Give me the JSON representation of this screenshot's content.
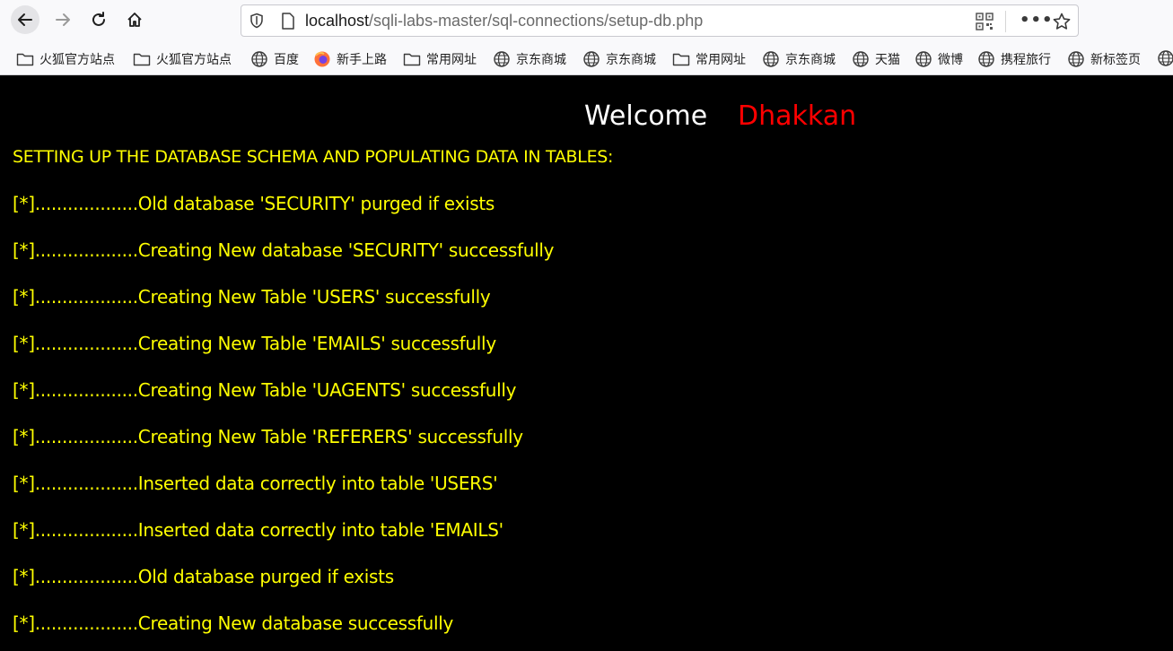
{
  "browser": {
    "url_host": "localhost",
    "url_path": "/sqli-labs-master/sql-connections/setup-db.php",
    "more_label": "•••",
    "bookmarks": [
      {
        "label": "火狐官方站点",
        "icon": "folder-icon"
      },
      {
        "label": "火狐官方站点",
        "icon": "folder-icon"
      },
      {
        "label": "百度",
        "icon": "globe-icon"
      },
      {
        "label": "新手上路",
        "icon": "firefox-icon"
      },
      {
        "label": "常用网址",
        "icon": "folder-icon"
      },
      {
        "label": "京东商城",
        "icon": "globe-icon"
      },
      {
        "label": "京东商城",
        "icon": "globe-icon"
      },
      {
        "label": "常用网址",
        "icon": "folder-icon"
      },
      {
        "label": "京东商城",
        "icon": "globe-icon"
      },
      {
        "label": "天猫",
        "icon": "globe-icon"
      },
      {
        "label": "微博",
        "icon": "globe-icon"
      },
      {
        "label": "携程旅行",
        "icon": "globe-icon"
      },
      {
        "label": "新标签页",
        "icon": "globe-icon"
      }
    ]
  },
  "page": {
    "welcome": "Welcome",
    "name": "Dhakkan",
    "heading": "SETTING UP THE DATABASE SCHEMA AND POPULATING DATA IN TABLES:",
    "lines": [
      "[*]...................Old database 'SECURITY' purged if exists",
      "[*]...................Creating New database 'SECURITY' successfully",
      "[*]...................Creating New Table 'USERS' successfully",
      "[*]...................Creating New Table 'EMAILS' successfully",
      "[*]...................Creating New Table 'UAGENTS' successfully",
      "[*]...................Creating New Table 'REFERERS' successfully",
      "[*]...................Inserted data correctly into table 'USERS'",
      "[*]...................Inserted data correctly into table 'EMAILS'",
      "[*]...................Old database purged if exists",
      "[*]...................Creating New database successfully"
    ]
  },
  "colors": {
    "page_bg": "#000000",
    "text_yellow": "#ffff00",
    "welcome_white": "#ffffff",
    "name_red": "#ff0000"
  }
}
